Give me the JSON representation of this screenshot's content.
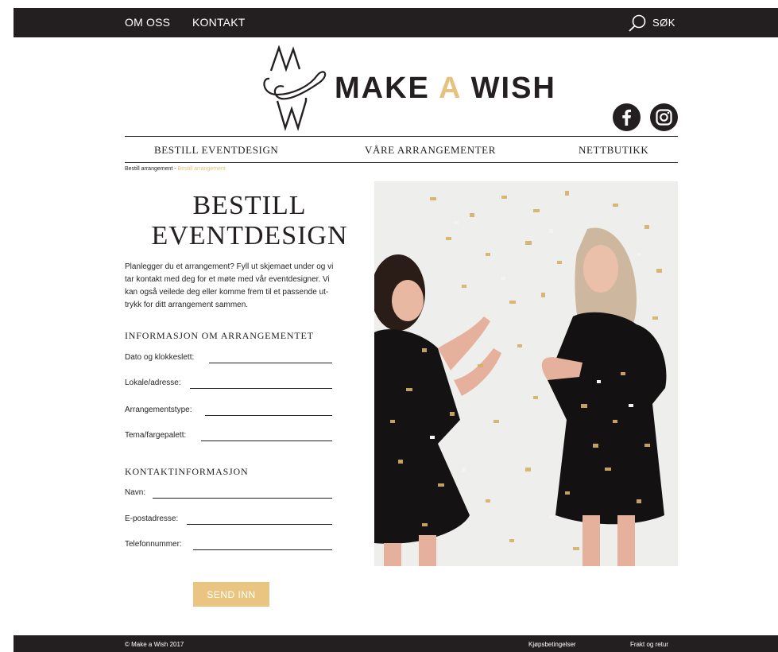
{
  "top_nav": {
    "items": [
      {
        "label": "OM OSS"
      },
      {
        "label": "KONTAKT"
      }
    ],
    "search_label": "SØK"
  },
  "logo": {
    "text_make": "MAKE",
    "text_a": "A",
    "text_wish": "WISH"
  },
  "social": [
    {
      "icon": "facebook-icon"
    },
    {
      "icon": "instagram-icon"
    }
  ],
  "main_nav": {
    "items": [
      {
        "label": "BESTILL EVENTDESIGN"
      },
      {
        "label": "VÅRE ARRANGEMENTER"
      },
      {
        "label": "NETTBUTIKK"
      }
    ]
  },
  "breadcrumb": {
    "parent": "Bestill arrangement",
    "separator": " - ",
    "current": "Bestill arrangement"
  },
  "page": {
    "title_line1": "BESTILL",
    "title_line2": "EVENTDESIGN",
    "intro_lines": [
      "Planlegger du et arrangement? Fyll ut skjemaet under og vi",
      "tar kontakt med deg for et møte med vår eventdesigner. Vi",
      "kan også veilede deg eller komme frem til et passende ut-",
      "trykk for ditt arrangement sammen."
    ]
  },
  "form": {
    "event_heading": "INFORMASJON OM ARRANGEMENTET",
    "event_fields": [
      {
        "label": "Dato og klokkeslett:",
        "value": ""
      },
      {
        "label": "Lokale/adresse:",
        "value": ""
      },
      {
        "label": "Arrangementstype:",
        "value": ""
      },
      {
        "label": "Tema/fargepalett:",
        "value": ""
      }
    ],
    "contact_heading": "KONTAKTINFORMASJON",
    "contact_fields": [
      {
        "label": "Navn:",
        "value": ""
      },
      {
        "label": "E-postadresse:",
        "value": ""
      },
      {
        "label": "Telefonnummer:",
        "value": ""
      }
    ],
    "submit_label": "SEND INN"
  },
  "footer": {
    "copyright": "© Make a Wish 2017",
    "links": [
      {
        "label": "Kjøpsbetingelser"
      },
      {
        "label": "Frakt og retur"
      }
    ]
  },
  "colors": {
    "dark": "#231f20",
    "accent": "#e6c27f",
    "button": "#e9c581"
  }
}
